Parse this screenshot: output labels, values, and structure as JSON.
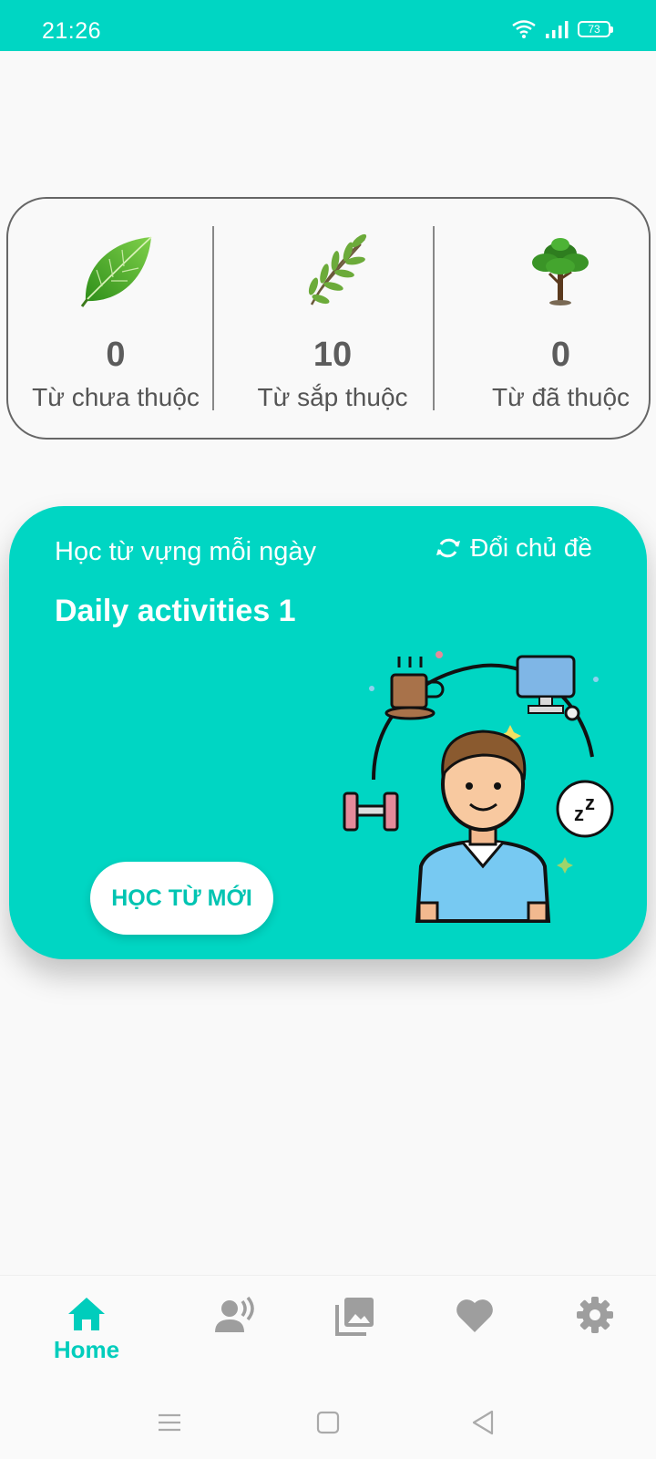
{
  "status_bar": {
    "time": "21:26",
    "battery": "73"
  },
  "stats": [
    {
      "value": "0",
      "label": "Từ chưa thuộc",
      "icon": "leaf-icon"
    },
    {
      "value": "10",
      "label": "Từ sắp thuộc",
      "icon": "sprig-icon"
    },
    {
      "value": "0",
      "label": "Từ đã thuộc",
      "icon": "tree-icon"
    }
  ],
  "daily": {
    "subtitle": "Học từ vựng mỗi ngày",
    "change_topic": "Đổi chủ đề",
    "title": "Daily activities 1",
    "button": "HỌC TỪ MỚI"
  },
  "nav": {
    "items": [
      {
        "label": "Home",
        "icon": "home-icon",
        "active": true
      },
      {
        "label": "",
        "icon": "speak-icon",
        "active": false
      },
      {
        "label": "",
        "icon": "gallery-icon",
        "active": false
      },
      {
        "label": "",
        "icon": "heart-icon",
        "active": false
      },
      {
        "label": "",
        "icon": "gear-icon",
        "active": false
      }
    ]
  },
  "colors": {
    "accent": "#00d6c3",
    "text_muted": "#5c5c5c",
    "icon_inactive": "#9e9e9e"
  }
}
